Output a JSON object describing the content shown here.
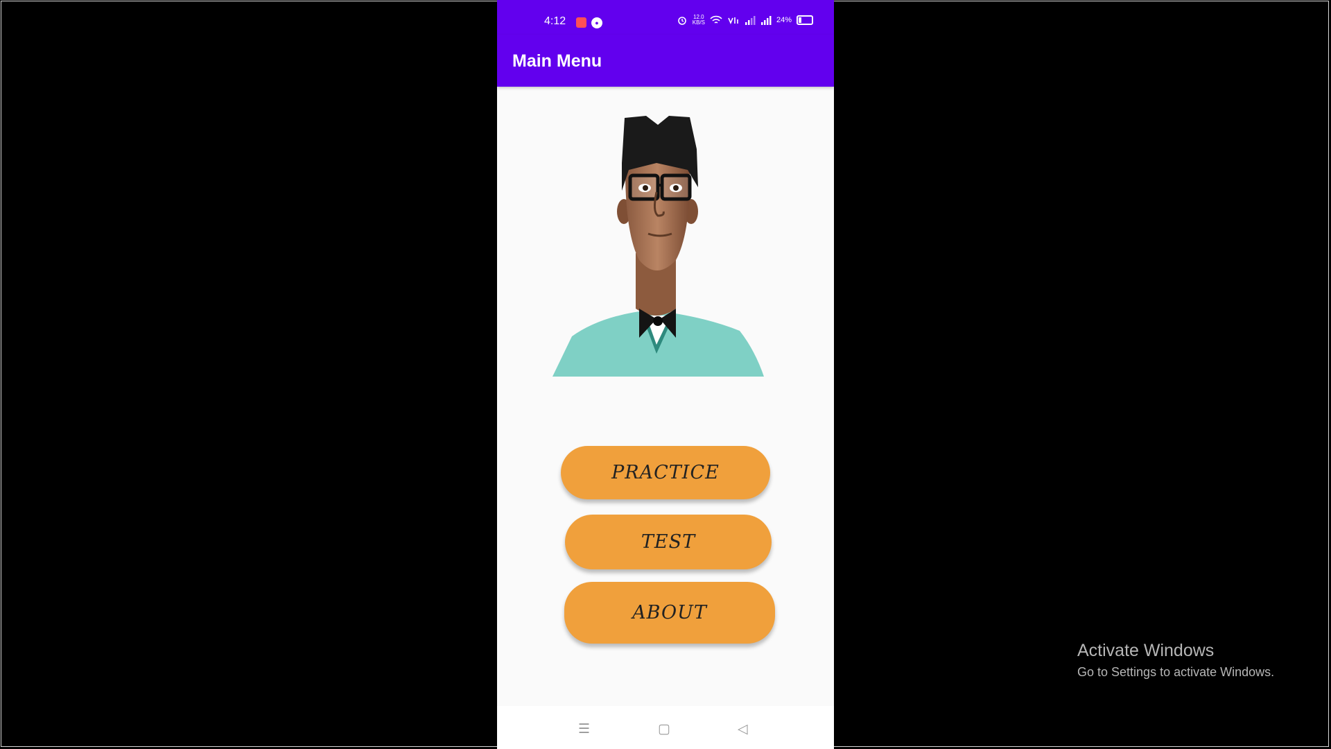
{
  "status_bar": {
    "time": "4:12",
    "notification_icons": [
      "screen-recorder-icon",
      "recording-badge-icon"
    ],
    "net_speed_value": "12.0",
    "net_speed_unit": "KB/S",
    "battery_percent": "24%",
    "battery_level": 0.24
  },
  "app_bar": {
    "title": "Main Menu"
  },
  "buttons": {
    "practice": "PRACTICE",
    "test": "TEST",
    "about": "ABOUT"
  },
  "colors": {
    "primary": "#6200ee",
    "button": "#f0a03c",
    "background": "#fafafa"
  },
  "watermark": {
    "title": "Activate Windows",
    "subtitle": "Go to Settings to activate Windows."
  }
}
